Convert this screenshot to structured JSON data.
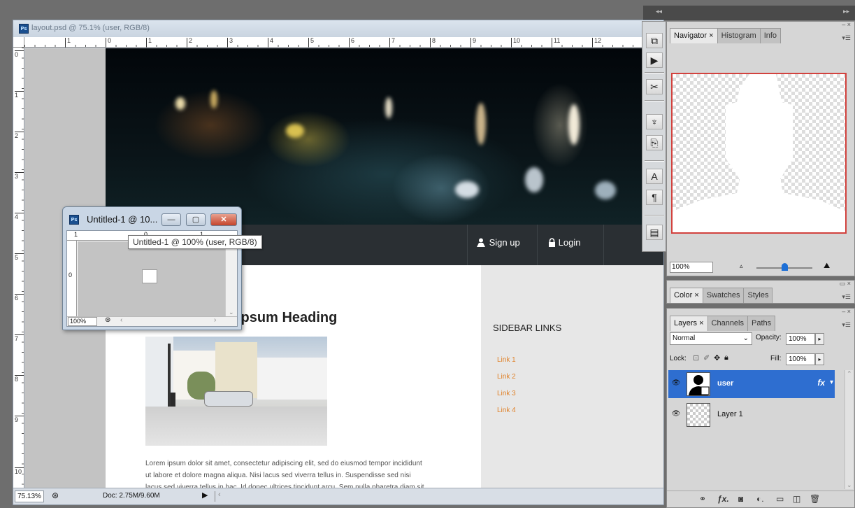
{
  "document": {
    "title": "layout.psd @ 75.1% (user, RGB/8)",
    "ruler_h": [
      "1",
      "0",
      "1",
      "2",
      "3",
      "4",
      "5",
      "6",
      "7",
      "8",
      "9",
      "10",
      "11",
      "12"
    ],
    "ruler_v": [
      "0",
      "1",
      "2",
      "3",
      "4",
      "5",
      "6",
      "7",
      "8",
      "9",
      "10"
    ],
    "status": {
      "zoom": "75.13%",
      "doc_size": "Doc: 2.75M/9.60M"
    }
  },
  "webpage": {
    "nav": {
      "signup": "Sign up",
      "login": "Login"
    },
    "heading_visible": "Ipsum  Heading",
    "paragraph": [
      "Lorem ipsum dolor sit amet, consectetur adipiscing elit, sed do eiusmod tempor incididunt",
      "ut labore et dolore magna aliqua. Nisi lacus sed viverra tellus in. Suspendisse sed nisi",
      "lacus sed viverra tellus in hac. Id donec ultrices tincidunt arcu. Sem nulla pharetra diam sit"
    ],
    "sidebar": {
      "title": "SIDEBAR LINKS",
      "links": [
        "Link 1",
        "Link 2",
        "Link 3",
        "Link 4"
      ]
    }
  },
  "float_window": {
    "title": "Untitled-1 @ 10...",
    "tooltip": "Untitled-1 @ 100% (user, RGB/8)",
    "ruler_h": [
      "1",
      "0",
      "1"
    ],
    "ruler_v": "0",
    "zoom": "100%",
    "buttons": {
      "minimize": "—",
      "maximize": "▢",
      "close": "✕"
    }
  },
  "navigator_panel": {
    "tabs": [
      "Navigator",
      "Histogram",
      "Info"
    ],
    "active_tab": "Navigator",
    "zoom": "100%"
  },
  "color_panel": {
    "tabs": [
      "Color",
      "Swatches",
      "Styles"
    ]
  },
  "layers_panel": {
    "tabs": [
      "Layers",
      "Channels",
      "Paths"
    ],
    "blend_mode": "Normal",
    "opacity_label": "Opacity:",
    "opacity": "100%",
    "lock_label": "Lock:",
    "fill_label": "Fill:",
    "fill": "100%",
    "layers": [
      {
        "name": "user",
        "selected": true,
        "fx": "fx"
      },
      {
        "name": "Layer 1",
        "selected": false
      }
    ]
  },
  "colors": {
    "accent_orange": "#e0822a",
    "selection_blue": "#2e6ed0",
    "navigator_frame": "#d2423e"
  }
}
